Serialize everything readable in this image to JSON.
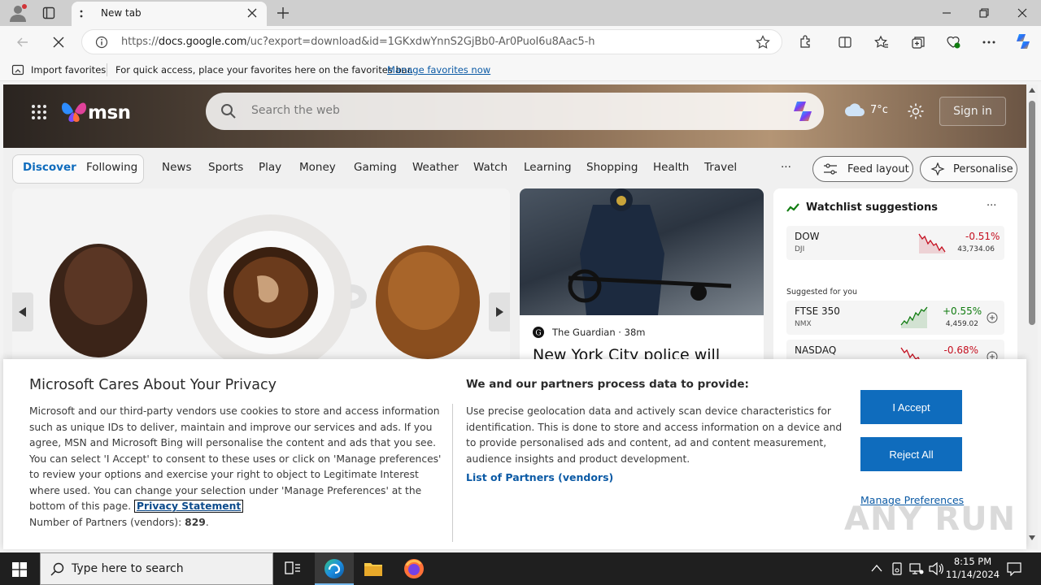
{
  "browser": {
    "tab_title": "New tab",
    "url_prefix": "https://",
    "url_domain": "docs.google.com",
    "url_path": "/uc?export=download&id=1GKxdwYnnS2GjBb0-Ar0PuoI6u8Aac5-h"
  },
  "favbar": {
    "import_label": "Import favorites",
    "hint": "For quick access, place your favorites here on the favorites bar.",
    "manage_link": "Manage favorites now"
  },
  "msn": {
    "logo_text": "msn",
    "search_placeholder": "Search the web",
    "temperature": "7°c",
    "sign_in": "Sign in",
    "tabs": [
      "Discover",
      "Following"
    ],
    "nav": [
      "News",
      "Sports",
      "Play",
      "Money",
      "Gaming",
      "Weather",
      "Watch",
      "Learning",
      "Shopping",
      "Health",
      "Travel"
    ],
    "more": "···",
    "feed_layout": "Feed layout",
    "personalise": "Personalise",
    "news_source": "The Guardian",
    "news_time": "38m",
    "news_headline": "New York City police will",
    "watchlist_title": "Watchlist suggestions",
    "suggested_label": "Suggested for you",
    "stocks": [
      {
        "name": "DOW",
        "exchange": "DJI",
        "change": "-0.51%",
        "value": "43,734.06",
        "color": "#c50f1f"
      },
      {
        "name": "FTSE 350",
        "exchange": "NMX",
        "change": "+0.55%",
        "value": "4,459.02",
        "color": "#0f7b0f"
      },
      {
        "name": "NASDAQ",
        "exchange": "",
        "change": "-0.68%",
        "value": "",
        "color": "#c50f1f"
      }
    ]
  },
  "privacy": {
    "title": "Microsoft Cares About Your Privacy",
    "body": "Microsoft and our third-party vendors use cookies to store and access information such as unique IDs to deliver, maintain and improve our services and ads. If you agree, MSN and Microsoft Bing will personalise the content and ads that you see. You can select 'I Accept' to consent to these uses or click on 'Manage preferences' to review your options and exercise your right to object to Legitimate Interest where used.  You can change your selection under 'Manage Preferences' at the bottom of this page.",
    "privacy_statement": "Privacy Statement",
    "partners_label": "Number of Partners (vendors):",
    "partners_count": "829",
    "partners_suffix": ".",
    "heading2": "We and our partners process data to provide:",
    "body2": "Use precise geolocation data and actively scan device characteristics for identification. This is done to store and access information on a device and to provide personalised ads and content, ad and content measurement, audience insights and product development.",
    "vendors_link": "List of Partners (vendors)",
    "accept": "I Accept",
    "reject": "Reject All",
    "manage": "Manage Preferences"
  },
  "taskbar": {
    "search_placeholder": "Type here to search",
    "time": "8:15 PM",
    "date": "11/14/2024"
  },
  "watermark": "ANY RUN"
}
